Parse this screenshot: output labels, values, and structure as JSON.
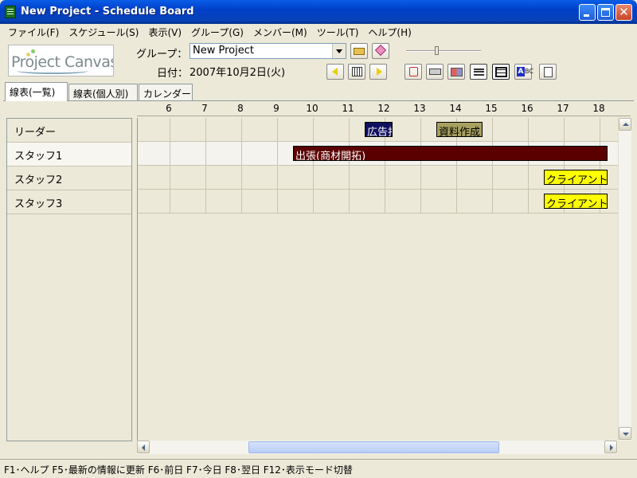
{
  "window": {
    "title": "New Project - Schedule Board"
  },
  "menu": [
    "ファイル(F)",
    "スケジュール(S)",
    "表示(V)",
    "グループ(G)",
    "メンバー(M)",
    "ツール(T)",
    "ヘルプ(H)"
  ],
  "logo": {
    "text": "Project Canvas"
  },
  "toolbar": {
    "group_label": "グループ：",
    "group_value": "New Project",
    "date_label": "日付：",
    "date_value": "2007年10月2日(火)"
  },
  "tabs": [
    "線表(一覧)",
    "線表(個人別)",
    "カレンダー"
  ],
  "hours": [
    "6",
    "7",
    "8",
    "9",
    "10",
    "11",
    "12",
    "13",
    "14",
    "15",
    "16",
    "17",
    "18"
  ],
  "members": [
    "リーダー",
    "スタッフ1",
    "スタッフ2",
    "スタッフ3"
  ],
  "events": [
    {
      "member": "リーダー",
      "label": "広告打",
      "start": "11:00",
      "end": "12:00",
      "color": "#101060",
      "text_color": "#FFFFFF"
    },
    {
      "member": "リーダー",
      "label": "資料作成",
      "start": "13:00",
      "end": "14:30",
      "color": "#A8A060",
      "text_color": "#000000"
    },
    {
      "member": "スタッフ1",
      "label": "出張(商材開拓)",
      "start": "9:00",
      "end": "18:00",
      "color": "#5A0000",
      "text_color": "#FFFFFF"
    },
    {
      "member": "スタッフ2",
      "label": "クライアント打",
      "start": "16:00",
      "end": "18:00",
      "color": "#FFFF00",
      "text_color": "#000000"
    },
    {
      "member": "スタッフ3",
      "label": "クライアント打",
      "start": "16:00",
      "end": "18:00",
      "color": "#FFFF00",
      "text_color": "#000000"
    }
  ],
  "status": "F1･ヘルプ  F5･最新の情報に更新  F6･前日  F7･今日  F8･翌日  F12･表示モード切替"
}
